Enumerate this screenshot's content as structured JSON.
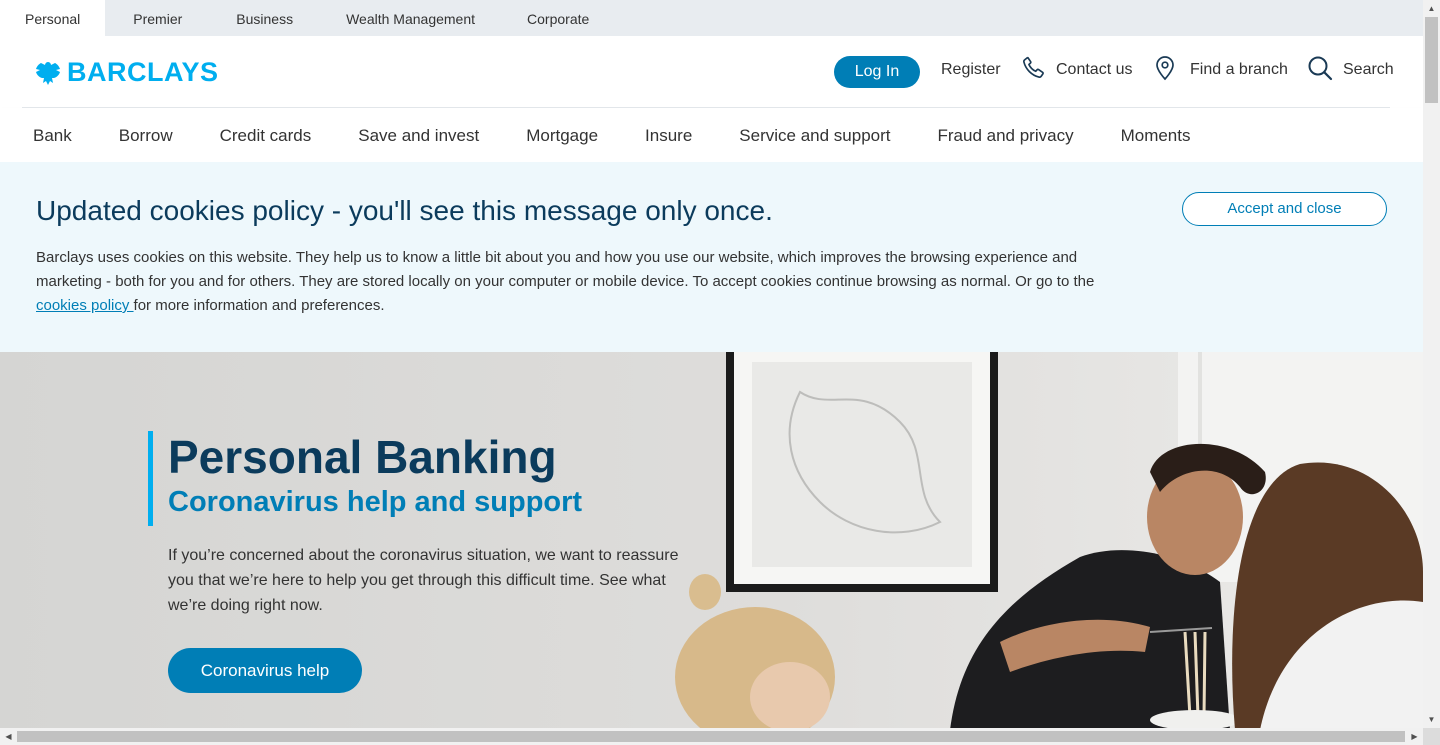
{
  "segments": {
    "items": [
      {
        "label": "Personal",
        "active": true
      },
      {
        "label": "Premier"
      },
      {
        "label": "Business"
      },
      {
        "label": "Wealth Management"
      },
      {
        "label": "Corporate"
      }
    ]
  },
  "header": {
    "logo_text": "BARCLAYS",
    "login_label": "Log In",
    "register_label": "Register",
    "contact_label": "Contact us",
    "branch_label": "Find a branch",
    "search_label": "Search",
    "icons": {
      "contact": "phone-icon",
      "branch": "location-pin-icon",
      "search": "search-icon",
      "logo": "eagle-logo-icon"
    }
  },
  "nav": {
    "items": [
      "Bank",
      "Borrow",
      "Credit cards",
      "Save and invest",
      "Mortgage",
      "Insure",
      "Service and support",
      "Fraud and privacy",
      "Moments"
    ]
  },
  "cookie": {
    "title": "Updated cookies policy - you'll see this message only once.",
    "text_before": "Barclays uses cookies on this website. They help us to know a little bit about you and how you use our website, which improves the browsing experience and marketing - both for you and for others. They are stored locally on your computer or mobile device. To accept cookies continue browsing as normal. Or go to the ",
    "link_text": "cookies policy ",
    "text_after": "for more information and preferences.",
    "accept_label": "Accept and close"
  },
  "hero": {
    "title": "Personal Banking",
    "subtitle": "Coronavirus help and support",
    "body": "If you’re concerned about the coronavirus situation, we want to reassure you that we’re here to help you get through this difficult time. See what we’re doing right now.",
    "button_label": "Coronavirus help"
  },
  "colors": {
    "brand": "#00aeef",
    "primary": "#007eb6",
    "navy": "#0b3b5c",
    "banner_bg": "#eef8fc"
  }
}
